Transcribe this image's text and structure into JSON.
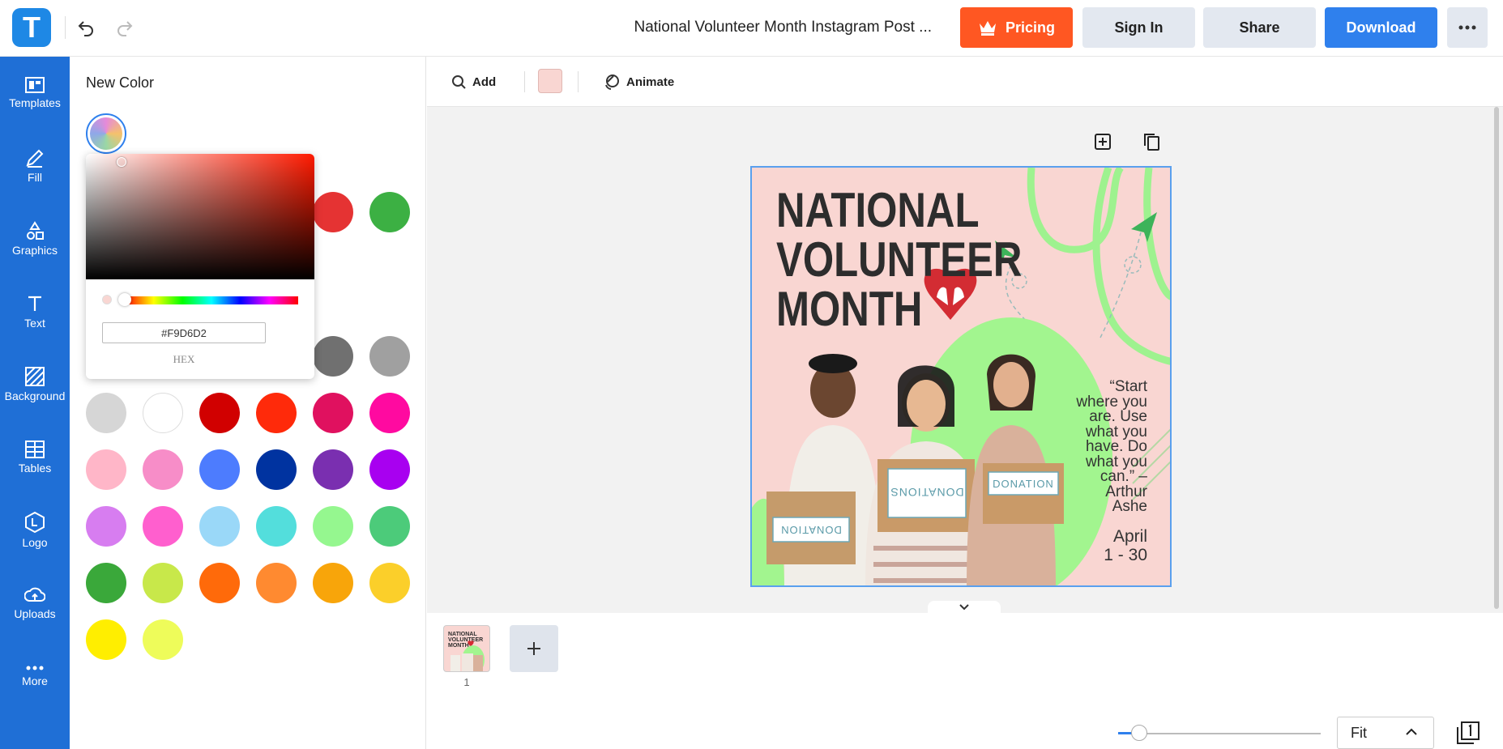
{
  "app": {
    "logo_letter": "T"
  },
  "header": {
    "doc_title": "National Volunteer Month Instagram Post ...",
    "pricing_label": "Pricing",
    "signin_label": "Sign In",
    "share_label": "Share",
    "download_label": "Download"
  },
  "sidebar": {
    "items": [
      {
        "label": "Templates",
        "icon": "templates-icon"
      },
      {
        "label": "Fill",
        "icon": "pencil-icon"
      },
      {
        "label": "Graphics",
        "icon": "shapes-icon"
      },
      {
        "label": "Text",
        "icon": "text-icon"
      },
      {
        "label": "Background",
        "icon": "background-icon"
      },
      {
        "label": "Tables",
        "icon": "table-icon"
      },
      {
        "label": "Logo",
        "icon": "logo-icon"
      },
      {
        "label": "Uploads",
        "icon": "upload-icon"
      },
      {
        "label": "More",
        "icon": "more-icon"
      }
    ]
  },
  "color_panel": {
    "title": "New Color",
    "hex_value": "#F9D6D2",
    "hex_label": "HEX",
    "partial_swatches": [
      "#e53333",
      "#3cb043"
    ],
    "swatches": [
      [
        "#000000",
        "#1f2a44",
        "#4d4d4d",
        "#e6e6e6",
        "#707070",
        "#a0a0a0"
      ],
      [
        "#d6d6d6",
        "#ffffff",
        "#d10000",
        "#ff2a0a",
        "#e0115f",
        "#ff0aa0"
      ],
      [
        "#ffb6c8",
        "#f78dc8",
        "#4d7cfe",
        "#0033a0",
        "#7a2fb0",
        "#a800f0"
      ],
      [
        "#d77df0",
        "#ff5fce",
        "#9ad8f8",
        "#53dedc",
        "#95f78f",
        "#4ccb7a"
      ],
      [
        "#3aa83a",
        "#c8e84a",
        "#ff6a0a",
        "#ff8a30",
        "#f8a50a",
        "#fbcf2a"
      ],
      [
        "#ffee00",
        "#eefc5a"
      ]
    ]
  },
  "canvas_toolbar": {
    "add_label": "Add",
    "fill_color": "#F9D6D2",
    "animate_label": "Animate"
  },
  "design": {
    "background": "#F9D6D2",
    "headline": [
      "NATIONAL",
      "VOLUNTEER",
      "MONTH"
    ],
    "quote": [
      "“Start",
      "where you",
      "are. Use",
      "what you",
      "have. Do",
      "what you",
      "can.” –",
      "Arthur",
      "Ashe"
    ],
    "date": [
      "April",
      "1 - 30"
    ],
    "box_labels": [
      "DONATION",
      "DONATIONS",
      "DONATION"
    ]
  },
  "pages": {
    "page_number": "1"
  },
  "zoom": {
    "label": "Fit"
  }
}
